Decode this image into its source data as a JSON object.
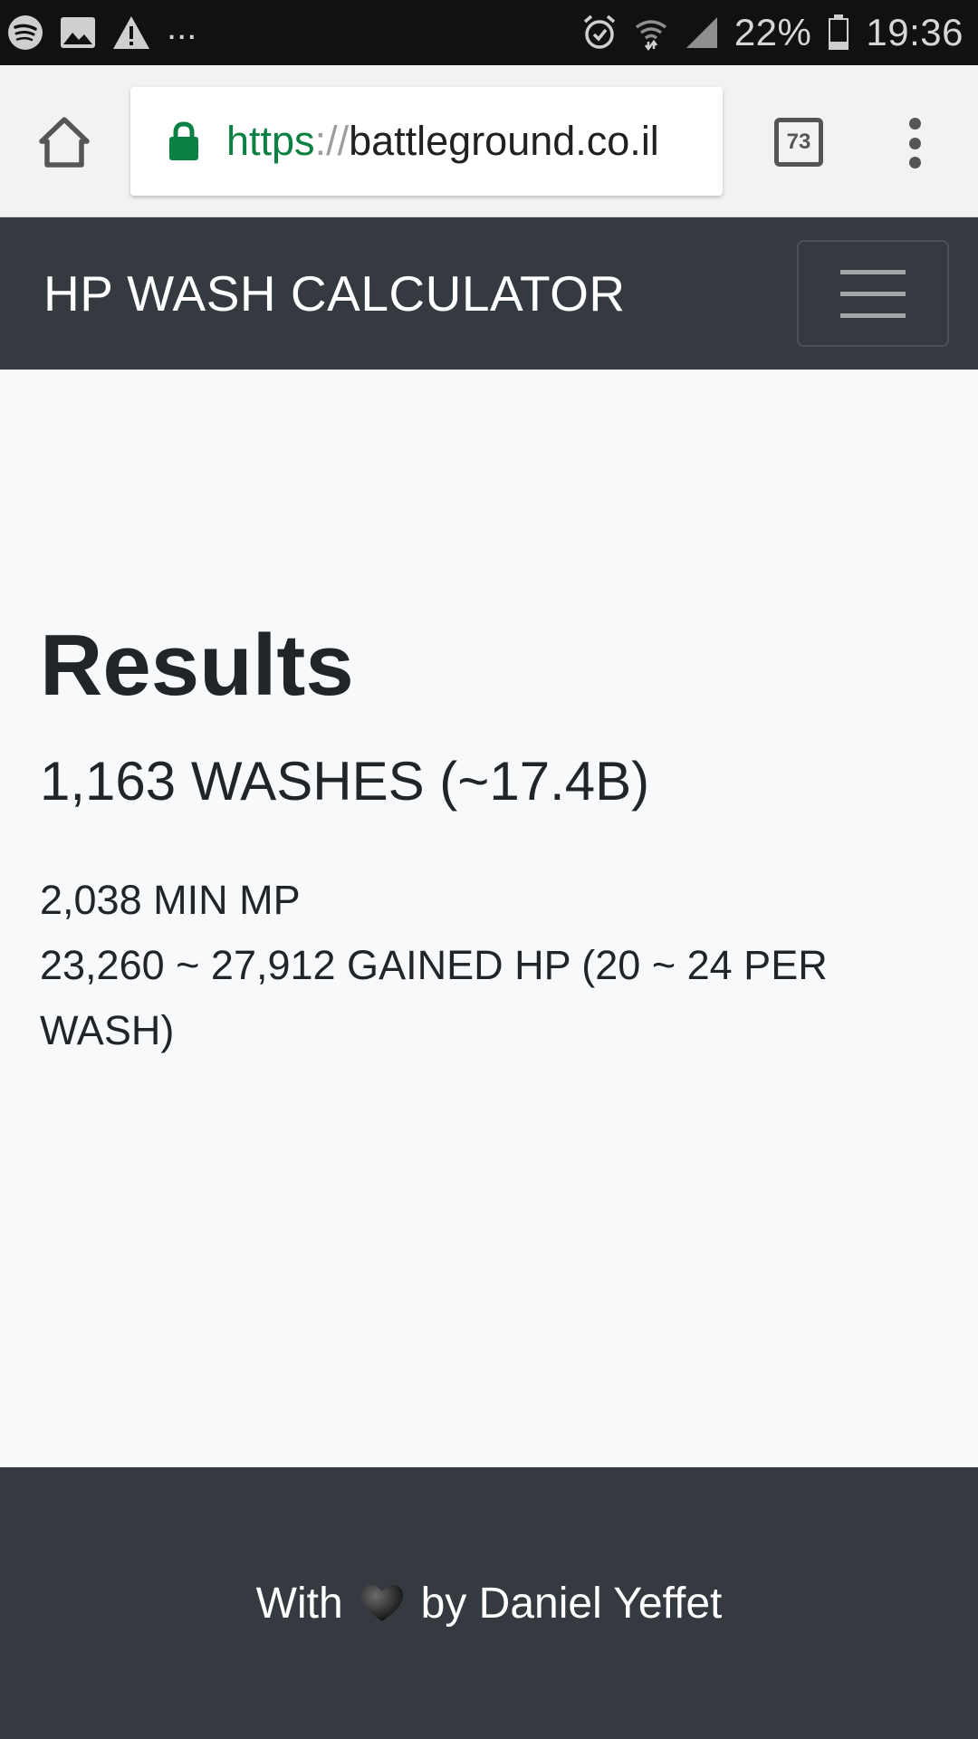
{
  "status_bar": {
    "battery": "22%",
    "time": "19:36",
    "more": "..."
  },
  "browser": {
    "url_scheme": "https",
    "url_sep": "://",
    "url_host": "battleground.co.il",
    "tab_count": "73"
  },
  "navbar": {
    "brand": "HP WASH CALCULATOR"
  },
  "results": {
    "title": "Results",
    "washes": "1,163 WASHES (~17.4B)",
    "min_mp": "2,038 MIN MP",
    "gained_hp": "23,260 ~ 27,912 GAINED HP (20 ~ 24 PER WASH)"
  },
  "footer": {
    "with": "With",
    "by": "by Daniel Yeffet"
  },
  "colors": {
    "navbar": "#343a40",
    "page_bg": "#f8f9fa",
    "url_green": "#0b8043",
    "statusbar": "#111111"
  }
}
